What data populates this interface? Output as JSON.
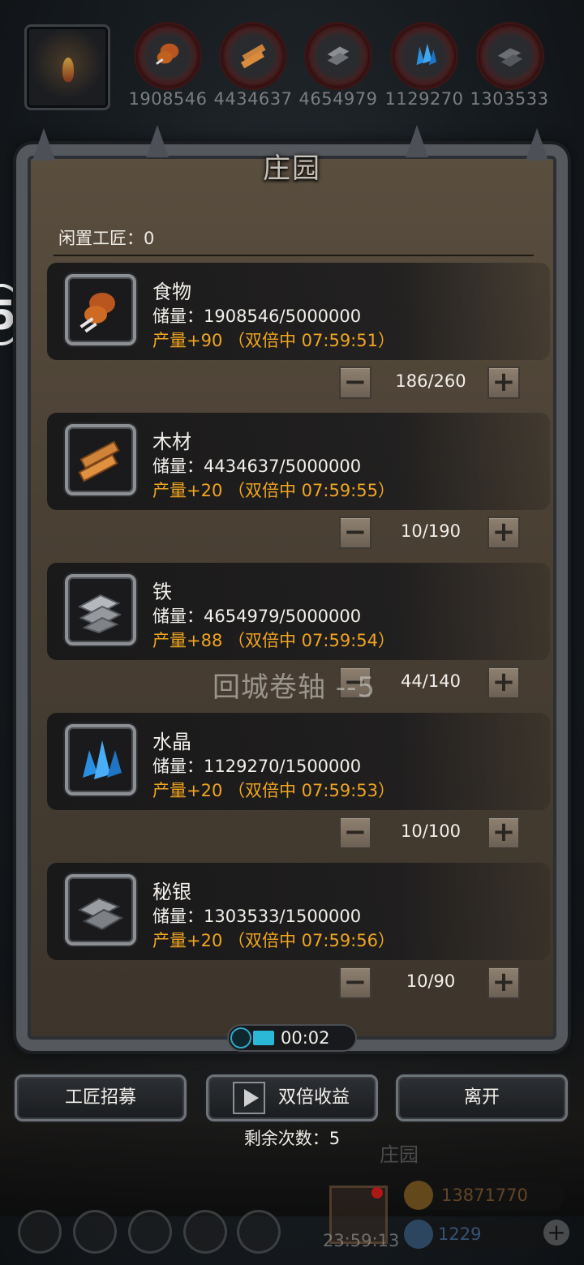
{
  "top_bar": {
    "resources": [
      {
        "name": "food",
        "icon": "drumstick-icon",
        "value": "1908546"
      },
      {
        "name": "wood",
        "icon": "wood-planks-icon",
        "value": "4434637"
      },
      {
        "name": "iron",
        "icon": "iron-ingot-icon",
        "value": "4654979"
      },
      {
        "name": "crystal",
        "icon": "crystal-icon",
        "value": "1129270"
      },
      {
        "name": "mithril",
        "icon": "mithril-ingot-icon",
        "value": "1303533"
      }
    ]
  },
  "panel": {
    "title": "庄园",
    "idle_workers": "闲置工匠：0",
    "rows": [
      {
        "name": "食物",
        "storage": "储量：1908546/5000000",
        "production": "产量+90 （双倍中 07:59:51）",
        "workers": "186/260",
        "icon": "drumstick-icon"
      },
      {
        "name": "木材",
        "storage": "储量：4434637/5000000",
        "production": "产量+20 （双倍中 07:59:55）",
        "workers": "10/190",
        "icon": "wood-planks-icon"
      },
      {
        "name": "铁",
        "storage": "储量：4654979/5000000",
        "production": "产量+88 （双倍中 07:59:54）",
        "workers": "44/140",
        "icon": "iron-ingot-icon"
      },
      {
        "name": "水晶",
        "storage": "储量：1129270/1500000",
        "production": "产量+20 （双倍中 07:59:53）",
        "workers": "10/100",
        "icon": "crystal-icon"
      },
      {
        "name": "秘银",
        "storage": "储量：1303533/1500000",
        "production": "产量+20 （双倍中 07:59:56）",
        "workers": "10/90",
        "icon": "mithril-ingot-icon"
      }
    ],
    "floating_text": "回城卷轴 --5",
    "timer": "00:02"
  },
  "actions": {
    "recruit": "工匠招募",
    "double": "双倍收益",
    "leave": "离开",
    "remaining": "剩余次数：5"
  },
  "background_hud": {
    "label": "庄园",
    "gift_timer": "23:59:13",
    "gold": "13871770",
    "gems": "1229",
    "side_badge": "5"
  },
  "colors": {
    "production": "#f0a520",
    "accent": "#2bb8d6"
  }
}
